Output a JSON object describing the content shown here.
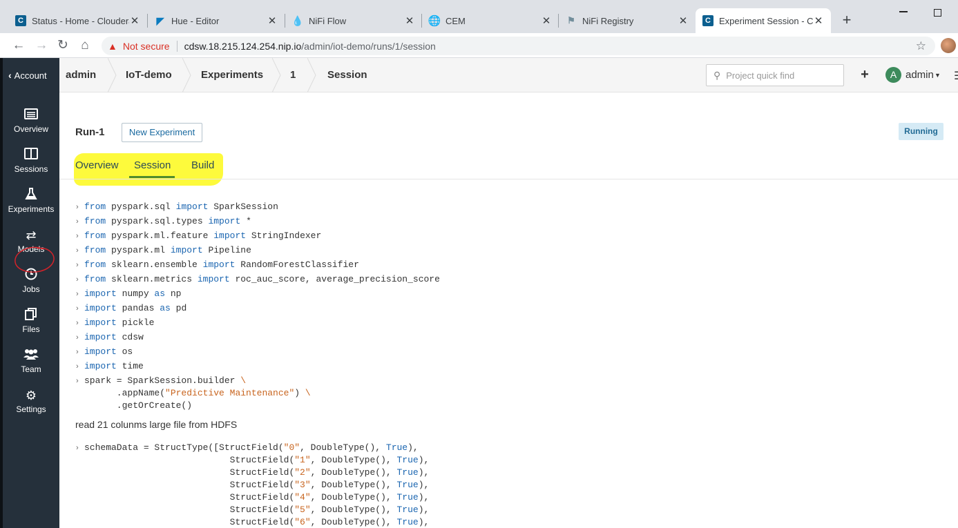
{
  "browser": {
    "tabs": [
      {
        "title": "Status - Home - Cloudera",
        "icon": "cloudera-c-icon"
      },
      {
        "title": "Hue - Editor",
        "icon": "hue-icon"
      },
      {
        "title": "NiFi Flow",
        "icon": "nifi-icon"
      },
      {
        "title": "CEM",
        "icon": "globe-icon"
      },
      {
        "title": "NiFi Registry",
        "icon": "nifi-registry-icon"
      },
      {
        "title": "Experiment Session - Clou",
        "icon": "cloudera-c-icon"
      }
    ],
    "url_security": "Not secure",
    "url_host": "cdsw.18.215.124.254.nip.io",
    "url_path": "/admin/iot-demo/runs/1/session"
  },
  "sidebar": {
    "account_label": "Account",
    "items": [
      {
        "label": "Overview",
        "icon": "overview-icon"
      },
      {
        "label": "Sessions",
        "icon": "sessions-icon"
      },
      {
        "label": "Experiments",
        "icon": "flask-icon"
      },
      {
        "label": "Models",
        "icon": "models-arrows-icon"
      },
      {
        "label": "Jobs",
        "icon": "clock-icon"
      },
      {
        "label": "Files",
        "icon": "files-icon"
      },
      {
        "label": "Team",
        "icon": "team-icon"
      },
      {
        "label": "Settings",
        "icon": "gear-icon"
      }
    ]
  },
  "breadcrumb": [
    "admin",
    "IoT-demo",
    "Experiments",
    "1",
    "Session"
  ],
  "header": {
    "quick_find_placeholder": "Project quick find",
    "user_initial": "A",
    "user_name": "admin"
  },
  "run": {
    "title": "Run-1",
    "new_experiment_label": "New Experiment",
    "status": "Running",
    "tabs": [
      "Overview",
      "Session",
      "Build"
    ],
    "active_tab": "Session"
  },
  "note": "read 21 colunms large file from HDFS",
  "colors": {
    "sidebar_bg": "#25303b",
    "highlight": "#fdfa3c",
    "active_tab_underline": "#4f8a2e",
    "keyword": "#1a65b0",
    "string": "#c8641e",
    "status_badge_bg": "#d5eaf5"
  }
}
